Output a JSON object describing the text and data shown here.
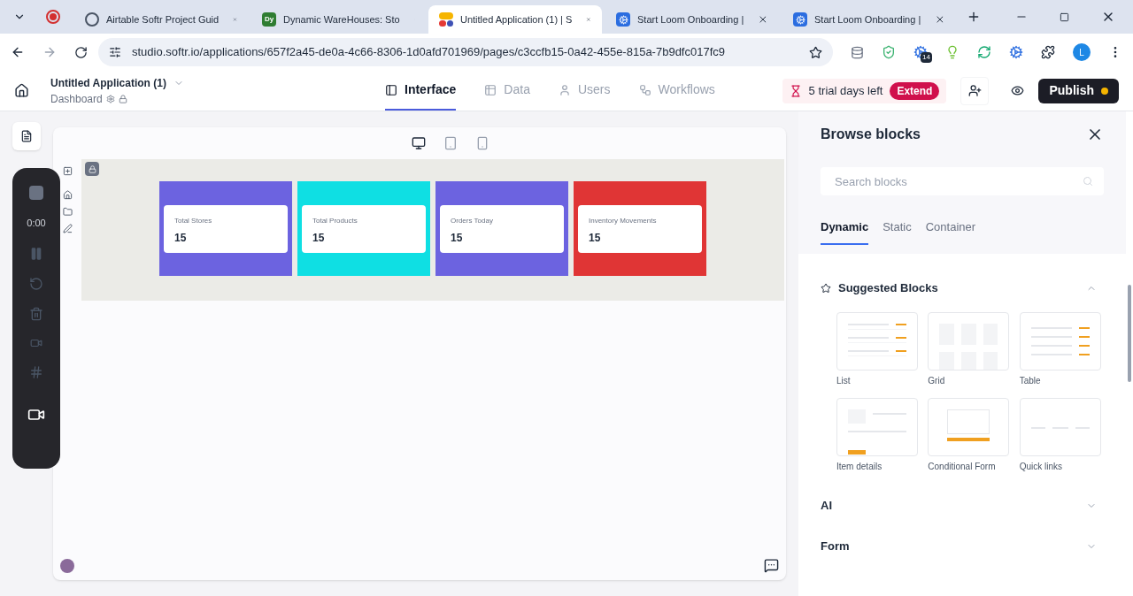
{
  "browser": {
    "tabs": [
      {
        "title": "Airtable Softr Project Guid",
        "selected": false
      },
      {
        "title": "Dynamic WareHouses: Sto",
        "icon_text": "Dy",
        "selected": false
      },
      {
        "title": "Untitled Application (1) | S",
        "selected": true
      },
      {
        "title": "Start Loom Onboarding |",
        "selected": false
      },
      {
        "title": "Start Loom Onboarding |",
        "selected": false
      }
    ],
    "url": "studio.softr.io/applications/657f2a45-de0a-4c66-8306-1d0afd701969/pages/c3ccfb15-0a42-455e-815a-7b9dfc017fc9",
    "extension_badge": "14",
    "profile": "L"
  },
  "app": {
    "title": "Untitled Application (1)",
    "page": "Dashboard",
    "nav": [
      {
        "label": "Interface",
        "selected": true
      },
      {
        "label": "Data",
        "selected": false
      },
      {
        "label": "Users",
        "selected": false
      },
      {
        "label": "Workflows",
        "selected": false
      }
    ],
    "trial": "5 trial days left",
    "extend": "Extend",
    "publish": "Publish"
  },
  "recorder": {
    "time": "0:00"
  },
  "canvas": {
    "devices": [
      {
        "kind": "desktop",
        "selected": true
      },
      {
        "kind": "tablet",
        "selected": false
      },
      {
        "kind": "mobile",
        "selected": false
      }
    ],
    "stats": [
      {
        "label": "Total Stores",
        "value": "15",
        "color": "#6c63e0"
      },
      {
        "label": "Total Products",
        "value": "15",
        "color": "#0fdfe3"
      },
      {
        "label": "Orders Today",
        "value": "15",
        "color": "#6c63e0"
      },
      {
        "label": "Inventory Movements",
        "value": "15",
        "color": "#e03535"
      }
    ]
  },
  "panel": {
    "title": "Browse blocks",
    "search": {
      "placeholder": "Search blocks"
    },
    "tabs": [
      {
        "label": "Dynamic",
        "selected": true
      },
      {
        "label": "Static",
        "selected": false
      },
      {
        "label": "Container",
        "selected": false
      }
    ],
    "sections": [
      {
        "title": "Suggested Blocks",
        "expanded": true,
        "blocks": [
          {
            "label": "List",
            "kind": "list"
          },
          {
            "label": "Grid",
            "kind": "grid"
          },
          {
            "label": "Table",
            "kind": "table"
          },
          {
            "label": "Item details",
            "kind": "details"
          },
          {
            "label": "Conditional Form",
            "kind": "form"
          },
          {
            "label": "Quick links",
            "kind": "links"
          }
        ]
      },
      {
        "title": "AI",
        "expanded": false
      },
      {
        "title": "Form",
        "expanded": false
      }
    ]
  }
}
